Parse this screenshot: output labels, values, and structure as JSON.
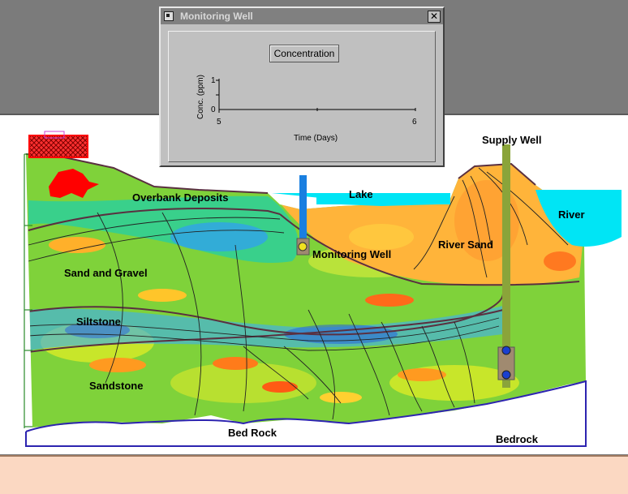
{
  "dialog": {
    "title": "Monitoring Well",
    "close_glyph": "✕",
    "button_label": "Concentration",
    "y_axis_label": "Conc. (ppm)",
    "x_axis_label": "Time (Days)",
    "y_ticks": [
      "1",
      "0"
    ],
    "x_ticks": [
      "5",
      "6"
    ]
  },
  "layers": {
    "overbank": "Overbank Deposits",
    "sand_gravel": "Sand and Gravel",
    "siltstone": "Siltstone",
    "sandstone": "Sandstone",
    "bed_rock": "Bed Rock",
    "bedrock_right": "Bedrock",
    "lake": "Lake",
    "river": "River",
    "river_sand": "River Sand",
    "monitoring_well": "Monitoring Well",
    "supply_well": "Supply Well"
  },
  "colors": {
    "water": "#00e5f5",
    "well_blue": "#1a7fe0",
    "supply_well": "#8aa43a",
    "bedrock_line": "#2d24b0",
    "source_red": "#ff0000"
  }
}
